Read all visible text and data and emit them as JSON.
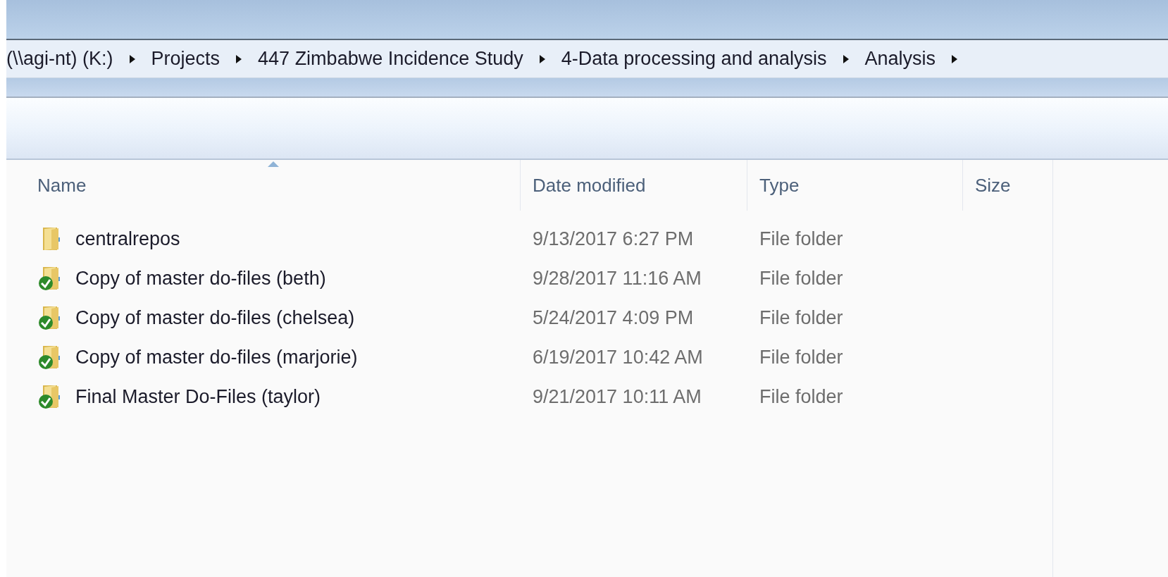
{
  "breadcrumb": [
    "(\\\\agi-nt) (K:)",
    "Projects",
    "447 Zimbabwe Incidence Study",
    "4-Data processing and analysis",
    "Analysis"
  ],
  "table": {
    "columns": [
      {
        "label": "Name",
        "sorted": true
      },
      {
        "label": "Date modified",
        "sorted": false
      },
      {
        "label": "Type",
        "sorted": false
      },
      {
        "label": "Size",
        "sorted": false
      }
    ],
    "rows": [
      {
        "name": "centralrepos",
        "date_modified": "9/13/2017 6:27 PM",
        "type": "File folder",
        "synced": false
      },
      {
        "name": "Copy of master do-files (beth)",
        "date_modified": "9/28/2017 11:16 AM",
        "type": "File folder",
        "synced": true
      },
      {
        "name": "Copy of master do-files (chelsea)",
        "date_modified": "5/24/2017 4:09 PM",
        "type": "File folder",
        "synced": true
      },
      {
        "name": "Copy of master do-files (marjorie)",
        "date_modified": "6/19/2017 10:42 AM",
        "type": "File folder",
        "synced": true
      },
      {
        "name": "Final Master Do-Files (taylor)",
        "date_modified": "9/21/2017 10:11 AM",
        "type": "File folder",
        "synced": true
      }
    ]
  }
}
